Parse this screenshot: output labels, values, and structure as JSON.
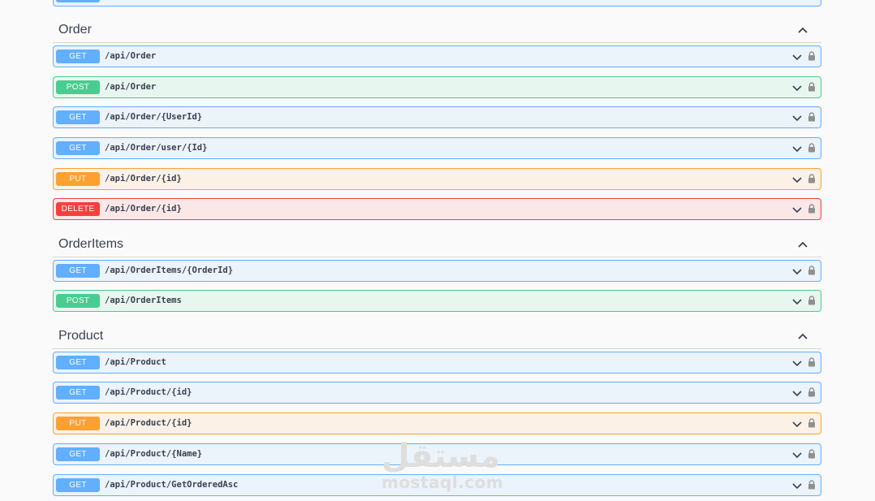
{
  "sections": [
    {
      "title": "Order",
      "operations": [
        {
          "method": "GET",
          "path": "/api/Order"
        },
        {
          "method": "POST",
          "path": "/api/Order"
        },
        {
          "method": "GET",
          "path": "/api/Order/{UserId}"
        },
        {
          "method": "GET",
          "path": "/api/Order/user/{Id}"
        },
        {
          "method": "PUT",
          "path": "/api/Order/{id}"
        },
        {
          "method": "DELETE",
          "path": "/api/Order/{id}"
        }
      ]
    },
    {
      "title": "OrderItems",
      "operations": [
        {
          "method": "GET",
          "path": "/api/OrderItems/{OrderId}"
        },
        {
          "method": "POST",
          "path": "/api/OrderItems"
        }
      ]
    },
    {
      "title": "Product",
      "operations": [
        {
          "method": "GET",
          "path": "/api/Product"
        },
        {
          "method": "GET",
          "path": "/api/Product/{id}"
        },
        {
          "method": "PUT",
          "path": "/api/Product/{id}"
        },
        {
          "method": "GET",
          "path": "/api/Product/{Name}"
        },
        {
          "method": "GET",
          "path": "/api/Product/GetOrderedAsc"
        }
      ]
    }
  ],
  "watermark": {
    "arabic": "مستقل",
    "latin": "mostaql.com"
  },
  "colors": {
    "get": "#61affe",
    "post": "#49cc90",
    "put": "#fca130",
    "delete": "#f93e3e"
  },
  "icons": {
    "section_toggle": "chevron-up-icon",
    "op_toggle": "chevron-down-icon",
    "auth": "lock-icon"
  }
}
